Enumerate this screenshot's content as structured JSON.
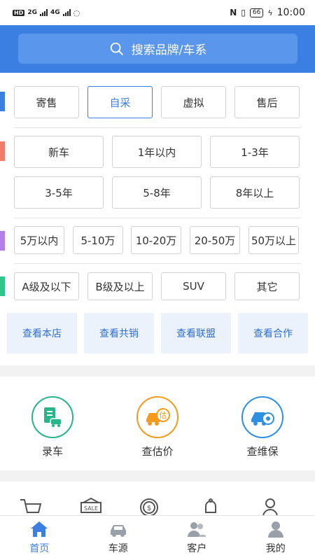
{
  "status": {
    "left_badge": "HD",
    "net1": "2G",
    "net2": "4G",
    "battery": "66",
    "time": "10:00"
  },
  "search": {
    "placeholder": "搜索品牌/车系"
  },
  "filters": {
    "source": [
      "寄售",
      "自采",
      "虚拟",
      "售后"
    ],
    "selected_source": "自采",
    "age": [
      "新车",
      "1年以内",
      "1-3年",
      "3-5年",
      "5-8年",
      "8年以上"
    ],
    "price": [
      "5万以内",
      "5-10万",
      "10-20万",
      "20-50万",
      "50万以上"
    ],
    "level": [
      "A级及以下",
      "B级及以上",
      "SUV",
      "其它"
    ],
    "accent_colors": [
      "#3b7fe3",
      "#f47a6b",
      "#b47de8",
      "#2fc48a"
    ]
  },
  "view_buttons": [
    "查看本店",
    "查看共销",
    "查看联盟",
    "查看合作"
  ],
  "actions": [
    {
      "label": "录车",
      "icon": "car-entry-icon",
      "color": "#27b58a"
    },
    {
      "label": "查估价",
      "icon": "valuation-icon",
      "color": "#f39a1f"
    },
    {
      "label": "查维保",
      "icon": "maintenance-icon",
      "color": "#2f8fe0"
    }
  ],
  "more_icons": [
    "cart-icon",
    "sale-icon",
    "dollar-coin-icon",
    "bell-icon",
    "user-key-icon"
  ],
  "tabs": [
    {
      "label": "首页",
      "icon": "home-icon",
      "active": true
    },
    {
      "label": "车源",
      "icon": "car-icon",
      "active": false
    },
    {
      "label": "客户",
      "icon": "customers-icon",
      "active": false
    },
    {
      "label": "我的",
      "icon": "profile-icon",
      "active": false
    }
  ]
}
